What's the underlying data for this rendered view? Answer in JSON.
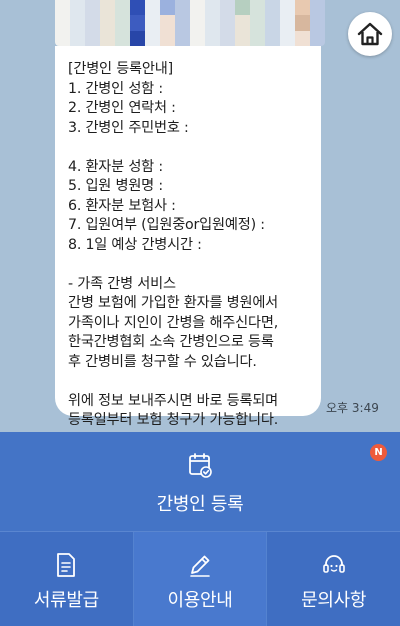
{
  "chat": {
    "message_lines": [
      "[간병인 등록안내]",
      "1. 간병인 성함 :",
      "2. 간병인 연락처 :",
      "3. 간병인 주민번호 :",
      "",
      "4. 환자분 성함 :",
      "5. 입원 병원명 :",
      "6. 환자분 보험사 :",
      "7. 입원여부 (입원중or입원예정) :",
      "8. 1일 예상 간병시간 :",
      "",
      "- 가족 간병 서비스",
      "간병 보험에 가입한 환자를 병원에서",
      "가족이나 지인이 간병을 해주신다면,",
      "한국간병협회 소속 간병인으로 등록",
      "후 간병비를 청구할 수 있습니다.",
      "",
      "위에 정보 보내주시면 바로 등록되며",
      "등록일부터 보험 청구가 가능합니다."
    ],
    "timestamp": "오후 3:49",
    "home_icon": "home-icon"
  },
  "menu": {
    "register": {
      "label": "간병인 등록",
      "icon": "calendar-check-icon",
      "badge": "N"
    },
    "documents": {
      "label": "서류발급",
      "icon": "document-icon"
    },
    "guide": {
      "label": "이용안내",
      "icon": "pencil-icon"
    },
    "inquiry": {
      "label": "문의사항",
      "icon": "headset-icon"
    }
  },
  "colors": {
    "chat_background": "#a8c0d6",
    "menu_background": "#3f6fc4",
    "badge": "#ee5b3c"
  }
}
